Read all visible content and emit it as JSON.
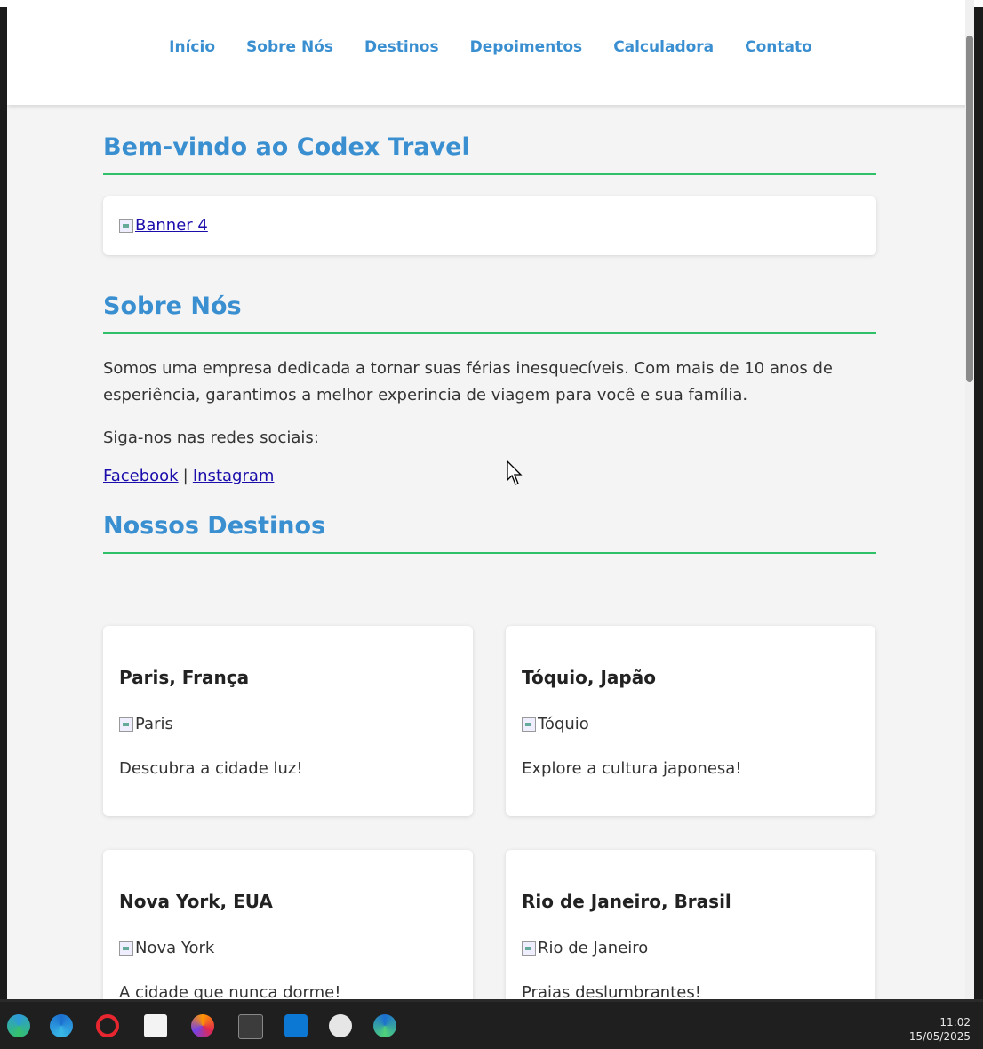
{
  "nav": {
    "items": [
      "Início",
      "Sobre Nós",
      "Destinos",
      "Depoimentos",
      "Calculadora",
      "Contato"
    ]
  },
  "welcome": {
    "title": "Bem-vindo ao Codex Travel",
    "banner_alt": "Banner 4"
  },
  "about": {
    "title": "Sobre Nós",
    "text": "Somos uma empresa dedicada a tornar suas férias inesquecíveis. Com mais de 10 anos de esperiência, garantimos a melhor experincia de viagem para você e sua família.",
    "social_prompt": "Siga-nos nas redes sociais:",
    "facebook": "Facebook",
    "separator": "|",
    "instagram": "Instagram"
  },
  "destinations": {
    "title": "Nossos Destinos",
    "cards": [
      {
        "name": "Paris, França",
        "img_alt": "Paris",
        "desc": "Descubra a cidade luz!"
      },
      {
        "name": "Tóquio, Japão",
        "img_alt": "Tóquio",
        "desc": "Explore a cultura japonesa!"
      },
      {
        "name": "Nova York, EUA",
        "img_alt": "Nova York",
        "desc": "A cidade que nunca dorme!"
      },
      {
        "name": "Rio de Janeiro, Brasil",
        "img_alt": "Rio de Janeiro",
        "desc": "Praias deslumbrantes!"
      }
    ]
  },
  "taskbar": {
    "icons": [
      "edge-dev-icon",
      "edge-beta-icon",
      "opera-icon",
      "file-explorer-icon",
      "firefox-icon",
      "terminal-icon",
      "vscode-icon",
      "cypress-icon",
      "edge-icon"
    ],
    "time": "11:02",
    "date": "15/05/2025"
  },
  "colors": {
    "accent": "#3a8fd1",
    "divider": "#2fc068",
    "link": "#1a0dab"
  }
}
